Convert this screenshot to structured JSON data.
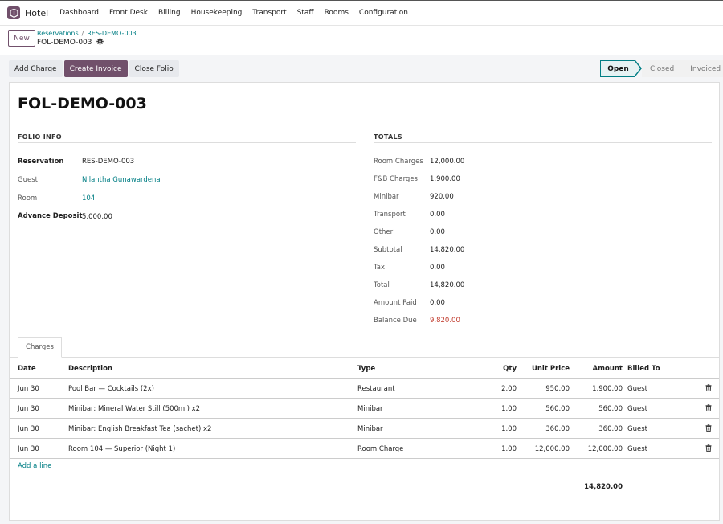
{
  "app": {
    "name": "Hotel",
    "menu": [
      "Dashboard",
      "Front Desk",
      "Billing",
      "Housekeeping",
      "Transport",
      "Staff",
      "Rooms",
      "Configuration"
    ]
  },
  "control": {
    "new_label": "New",
    "breadcrumb": [
      "Reservations",
      "RES-DEMO-003"
    ],
    "record": "FOL-DEMO-003"
  },
  "actions": {
    "add_charge": "Add Charge",
    "create_invoice": "Create Invoice",
    "close_folio": "Close Folio"
  },
  "status": {
    "stages": [
      "Open",
      "Closed",
      "Invoiced"
    ],
    "current": "Open"
  },
  "sheet": {
    "title": "FOL-DEMO-003",
    "folio_info": {
      "heading": "FOLIO INFO",
      "reservation_label": "Reservation",
      "reservation": "RES-DEMO-003",
      "guest_label": "Guest",
      "guest": "Nilantha Gunawardena",
      "room_label": "Room",
      "room": "104",
      "deposit_label": "Advance Deposit",
      "deposit": "5,000.00"
    },
    "totals": {
      "heading": "TOTALS",
      "rows": [
        {
          "label": "Room Charges",
          "value": "12,000.00"
        },
        {
          "label": "F&B Charges",
          "value": "1,900.00"
        },
        {
          "label": "Minibar",
          "value": "920.00"
        },
        {
          "label": "Transport",
          "value": "0.00"
        },
        {
          "label": "Other",
          "value": "0.00"
        },
        {
          "label": "Subtotal",
          "value": "14,820.00"
        },
        {
          "label": "Tax",
          "value": "0.00"
        },
        {
          "label": "Total",
          "value": "14,820.00"
        },
        {
          "label": "Amount Paid",
          "value": "0.00"
        },
        {
          "label": "Balance Due",
          "value": "9,820.00"
        }
      ]
    },
    "tab_label": "Charges",
    "table": {
      "headers": [
        "Date",
        "Description",
        "Type",
        "Qty",
        "Unit Price",
        "Amount",
        "Billed To"
      ],
      "rows": [
        [
          "Jun 30",
          "Pool Bar — Cocktails (2x)",
          "Restaurant",
          "2.00",
          "950.00",
          "1,900.00",
          "Guest"
        ],
        [
          "Jun 30",
          "Minibar: Mineral Water Still (500ml) x2",
          "Minibar",
          "1.00",
          "560.00",
          "560.00",
          "Guest"
        ],
        [
          "Jun 30",
          "Minibar: English Breakfast Tea (sachet) x2",
          "Minibar",
          "1.00",
          "360.00",
          "360.00",
          "Guest"
        ],
        [
          "Jun 30",
          "Room 104 — Superior (Night 1)",
          "Room Charge",
          "1.00",
          "12,000.00",
          "12,000.00",
          "Guest"
        ]
      ],
      "add_line": "Add a line",
      "footer_total": "14,820.00"
    }
  },
  "colors": {
    "brand": "#71506b",
    "link": "#017e84",
    "due": "#c0392b"
  }
}
